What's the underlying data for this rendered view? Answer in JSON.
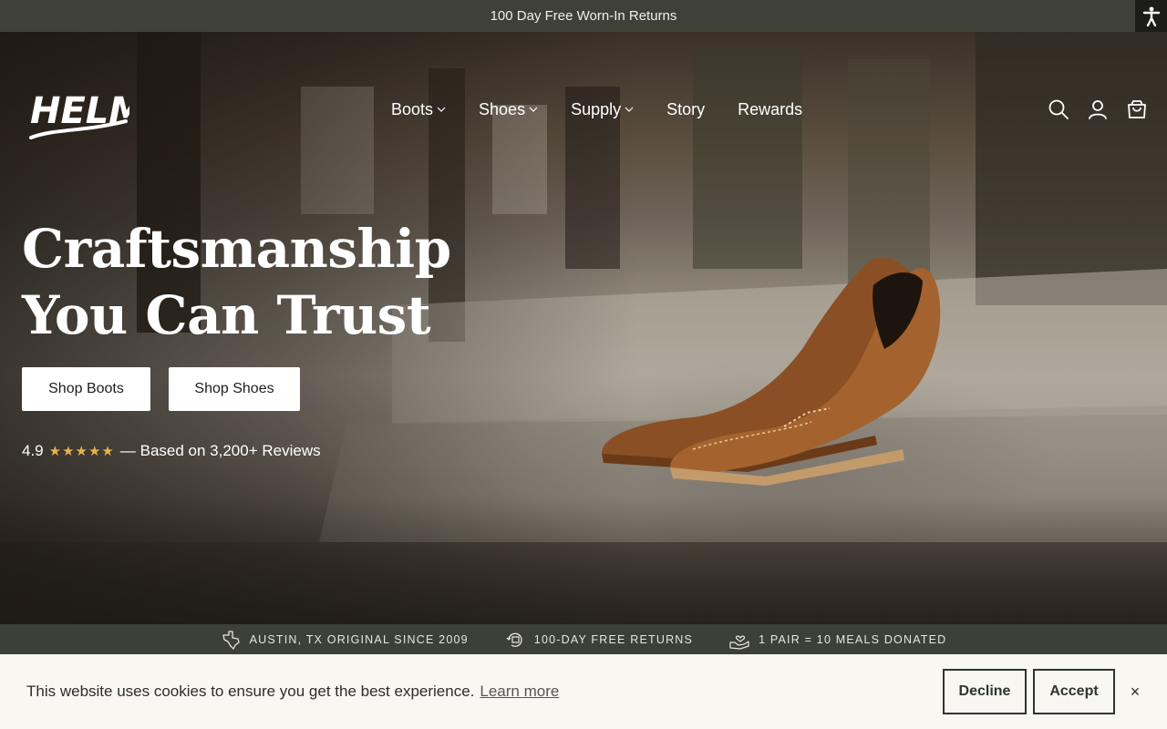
{
  "announcement": {
    "text": "100 Day Free Worn-In Returns"
  },
  "accessibility": {
    "icon": "accessibility-icon"
  },
  "logo": {
    "text": "HELM"
  },
  "nav": {
    "items": [
      {
        "label": "Boots",
        "has_dropdown": true
      },
      {
        "label": "Shoes",
        "has_dropdown": true
      },
      {
        "label": "Supply",
        "has_dropdown": true
      },
      {
        "label": "Story",
        "has_dropdown": false
      },
      {
        "label": "Rewards",
        "has_dropdown": false
      }
    ]
  },
  "header_icons": [
    "search-icon",
    "account-icon",
    "cart-icon"
  ],
  "hero": {
    "title_line1": "Craftsmanship",
    "title_line2": "You Can Trust",
    "cta_boots": "Shop Boots",
    "cta_shoes": "Shop Shoes",
    "rating_value": "4.9",
    "rating_stars": "★★★★★",
    "rating_text": "— Based on 3,200+ Reviews"
  },
  "features": [
    {
      "icon": "texas-icon",
      "label": "AUSTIN, TX ORIGINAL SINCE 2009"
    },
    {
      "icon": "returns-icon",
      "label": "100-DAY FREE RETURNS"
    },
    {
      "icon": "donation-icon",
      "label": "1 PAIR = 10 MEALS DONATED"
    }
  ],
  "cookie": {
    "message": "This website uses cookies to ensure you get the best experience.",
    "learn_more": "Learn more",
    "decline": "Decline",
    "accept": "Accept",
    "close": "×"
  },
  "colors": {
    "announcement_bg": "#3f4137",
    "feature_bg": "#3d4036",
    "cookie_bg": "#f8f7f2",
    "star": "#e6b24a"
  }
}
